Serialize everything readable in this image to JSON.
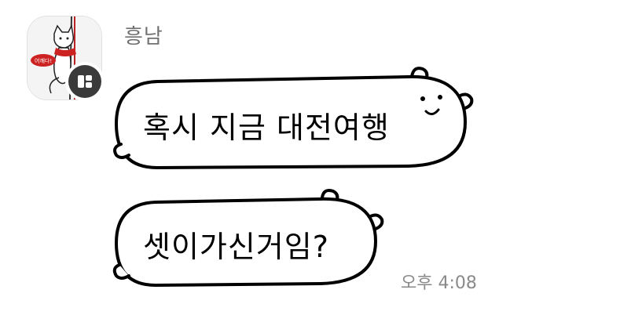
{
  "message_group": {
    "sender_name": "흥남",
    "avatar_icon": "profile-picture-cat-sticker",
    "avatar_badge_icon": "kakao-channel-badge-icon",
    "messages": [
      {
        "text": "혹시 지금 대전여행"
      },
      {
        "text": "셋이가신거임?"
      }
    ],
    "timestamp": "오후 4:08"
  },
  "colors": {
    "background": "#ffffff",
    "bubble_fill": "#ffffff",
    "bubble_outline": "#000000",
    "sender_name": "#707070",
    "timestamp": "#8a8a8a"
  }
}
